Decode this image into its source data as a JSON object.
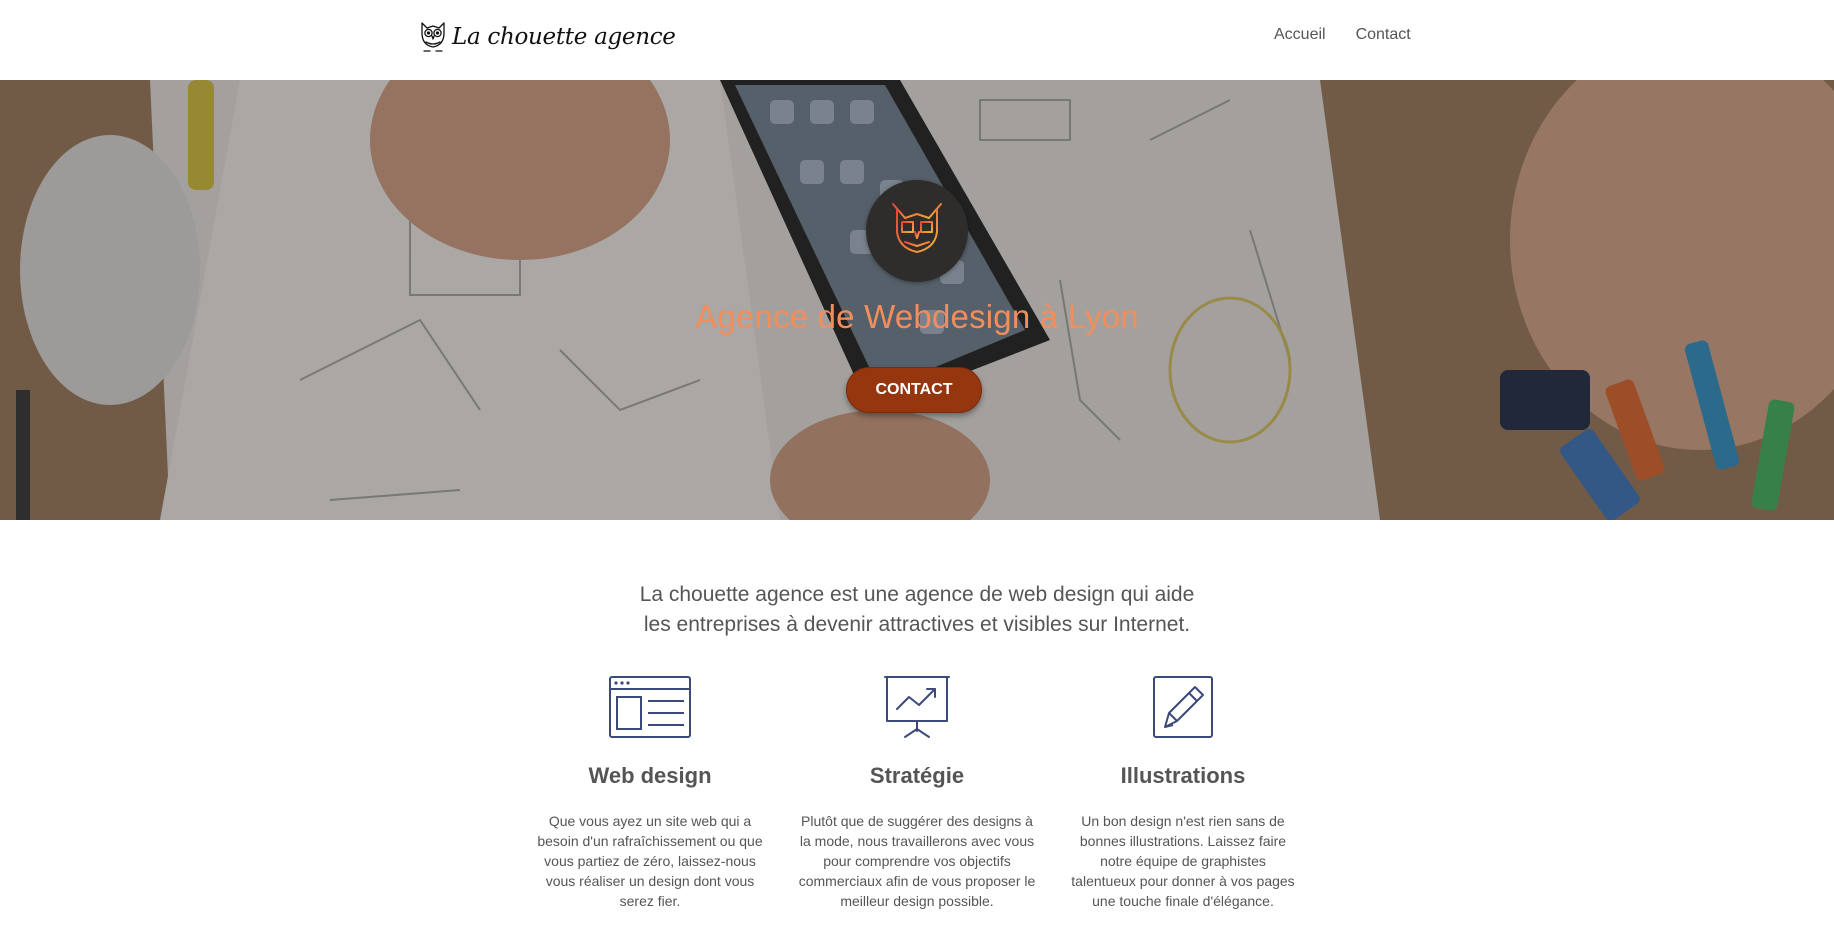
{
  "header": {
    "brand": "La chouette agence",
    "brand_icon": "owl-logo-icon",
    "nav": [
      {
        "label": "Accueil"
      },
      {
        "label": "Contact"
      }
    ]
  },
  "hero": {
    "logo_icon": "owl-emblem-icon",
    "title": "Agence de Webdesign à Lyon",
    "button_label": "CONTACT",
    "colors": {
      "title": "#f28e5c",
      "button": "#96360f",
      "logo_circle": "#2f2d2c"
    }
  },
  "intro": {
    "line1": "La chouette agence est une agence de web design qui aide",
    "line2": "les entreprises à devenir attractives et visibles sur Internet."
  },
  "services": [
    {
      "icon": "browser-window-icon",
      "title": "Web design",
      "text": "Que vous ayez un site web qui a besoin d'un rafraîchissement ou que vous partiez de zéro, laissez-nous vous réaliser un design dont vous serez fier."
    },
    {
      "icon": "presentation-chart-icon",
      "title": "Stratégie",
      "text": "Plutôt que de suggérer des designs à la mode, nous travaillerons avec vous pour comprendre vos objectifs commerciaux afin de vous proposer le meilleur design possible."
    },
    {
      "icon": "pencil-icon",
      "title": "Illustrations",
      "text": "Un bon design n'est rien sans de bonnes illustrations. Laissez faire notre équipe de graphistes talentueux pour donner à vos pages une touche finale d'élégance."
    }
  ],
  "colors": {
    "icon_stroke": "#3b4a7a",
    "text": "#555555"
  }
}
